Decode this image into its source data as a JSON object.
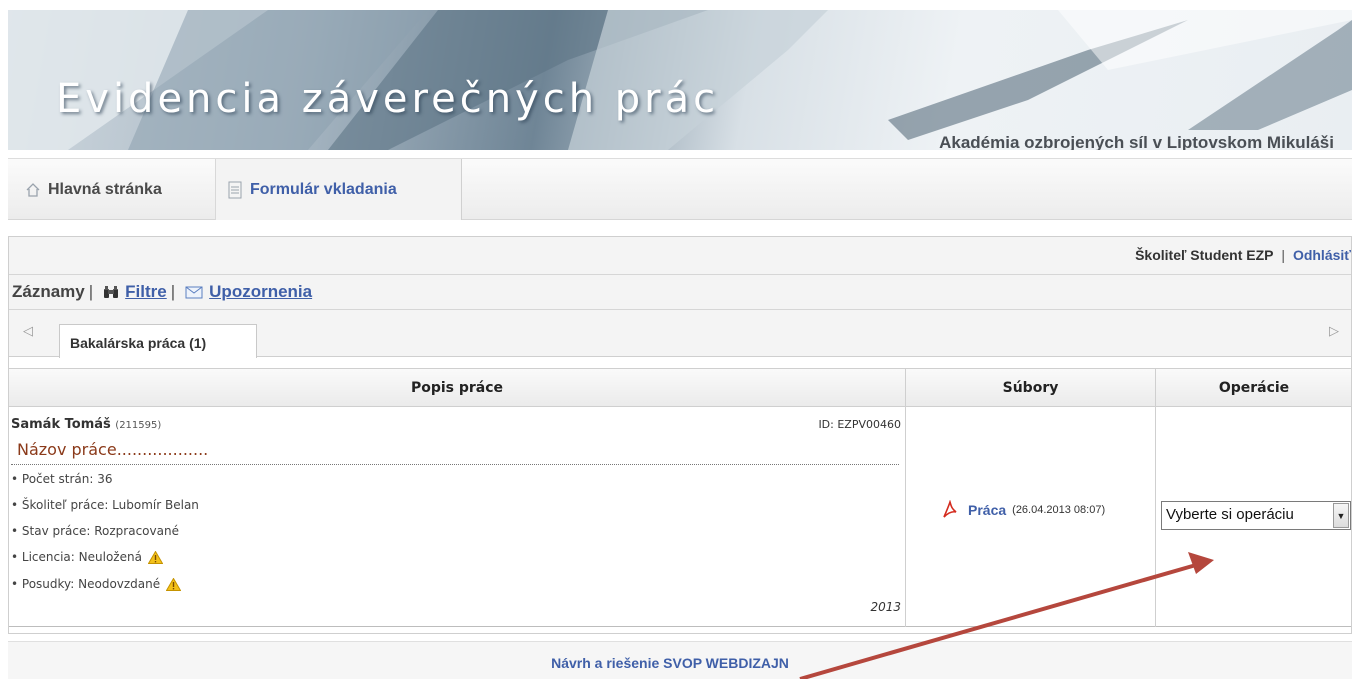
{
  "banner": {
    "title": "Evidencia záverečných prác",
    "subtitle": "Akadémia ozbrojených síl v Liptovskom Mikuláši"
  },
  "nav": {
    "home_label": "Hlavná stránka",
    "form_label": "Formulár vkladania"
  },
  "user": {
    "name": "Školiteľ Student EZP",
    "separator": "|",
    "logout_label": "Odhlásiť"
  },
  "records_bar": {
    "records_label": "Záznamy",
    "filters_label": "Filtre",
    "notifications_label": "Upozornenia",
    "separator": "|"
  },
  "tabs": [
    {
      "label": "Bakalárska práca (1)"
    }
  ],
  "table": {
    "headers": [
      "Popis práce",
      "Súbory",
      "Operácie"
    ],
    "row": {
      "author": "Samák Tomáš",
      "author_id": "(211595)",
      "record_id": "ID: EZPV00460",
      "title": "Názov práce..................",
      "details": [
        "• Počet strán: 36",
        "• Školiteľ práce: Lubomír Belan",
        "• Stav práce: Rozpracované",
        "• Licencia: Neuložená",
        "• Posudky: Neodovzdané"
      ],
      "year": "2013",
      "file_name": "Práca",
      "file_date": "(26.04.2013 08:07)",
      "operation_selected": "Vyberte si operáciu"
    }
  },
  "footer": {
    "text": "Návrh a riešenie SVOP WEBDIZAJN"
  },
  "colors": {
    "link": "#3f5fa8",
    "title_brown": "#8b3a1a",
    "arrow": "#b5473d",
    "warning": "#e8b400"
  },
  "icons": [
    "home-icon",
    "document-icon",
    "binoculars-icon",
    "envelope-icon",
    "warning-icon",
    "pdf-icon",
    "chevron-left-icon",
    "chevron-right-icon",
    "dropdown-arrow-icon"
  ]
}
